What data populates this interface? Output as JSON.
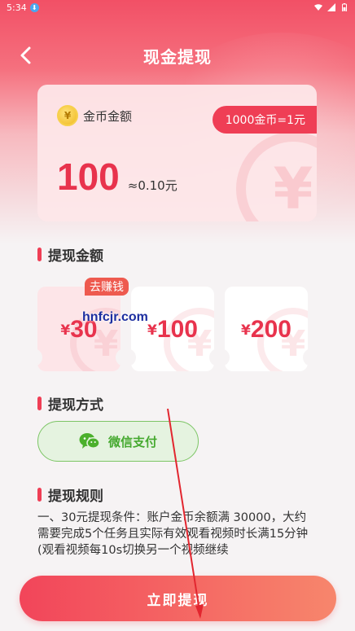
{
  "status_bar": {
    "time": "5:34"
  },
  "header": {
    "title": "现金提现"
  },
  "coin_card": {
    "label": "金币金额",
    "exchange_rate": "1000金币=1元",
    "balance": "100",
    "approx_value": "≈0.10元"
  },
  "amount_section": {
    "title": "提现金额",
    "earn_tag": "去赚钱",
    "currency_symbol": "¥",
    "options": [
      {
        "value": "30",
        "selected": true
      },
      {
        "value": "100",
        "selected": false
      },
      {
        "value": "200",
        "selected": false
      }
    ]
  },
  "watermark": "hnfcjr.com",
  "method_section": {
    "title": "提现方式",
    "option_label": "微信支付",
    "option_icon": "wechat-pay-icon"
  },
  "rules_section": {
    "title": "提现规则",
    "text": "一、30元提现条件：账户金币余额满 30000，大约需要完成5个任务且实际有效观看视频时长满15分钟(观看视频每10s切换另一个视频继续"
  },
  "submit": {
    "label": "立即提现"
  },
  "colors": {
    "accent": "#ef3e55",
    "wechat_green": "#45a92f"
  }
}
